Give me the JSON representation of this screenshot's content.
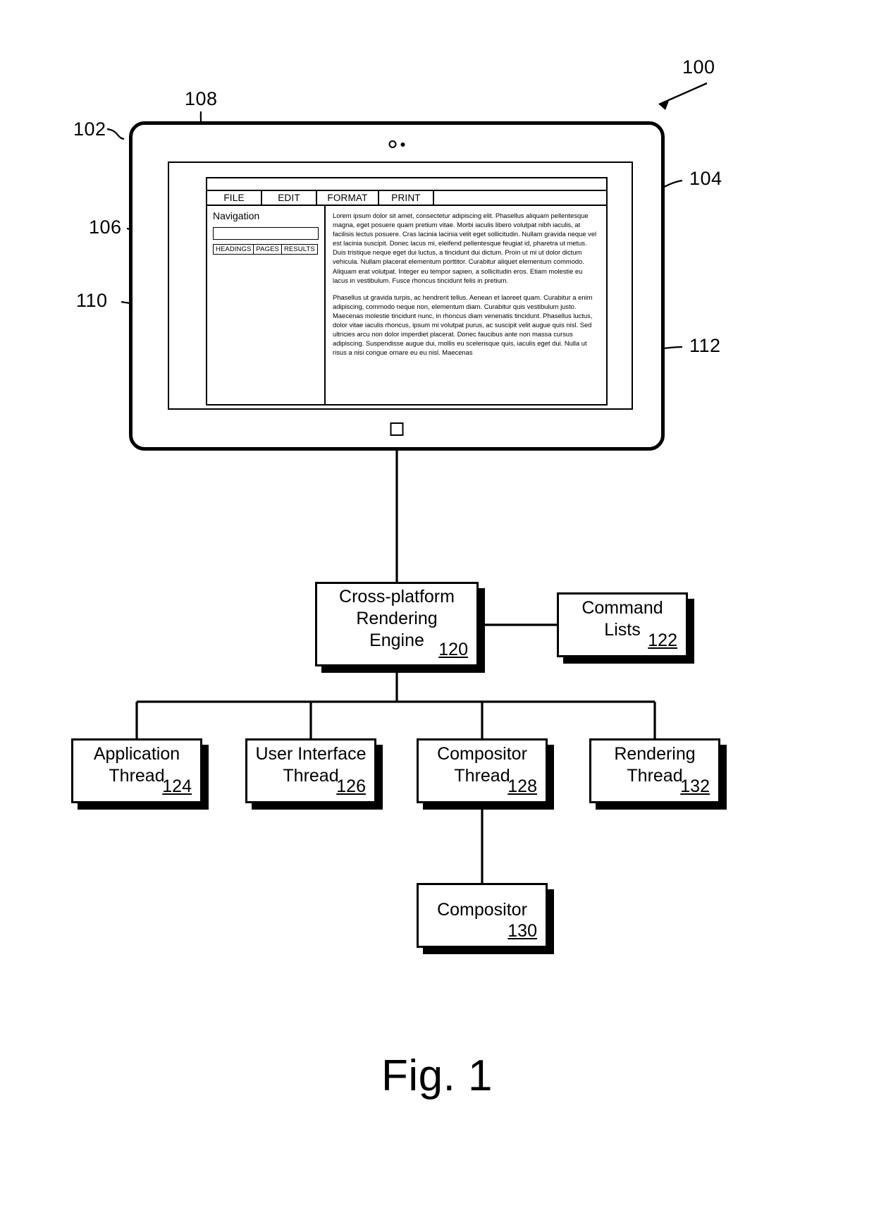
{
  "figure": {
    "caption": "Fig. 1",
    "top_ref": "100"
  },
  "refs": {
    "device": "102",
    "display": "104",
    "navigation_pane": "106",
    "menu_bar": "108",
    "nav_body": "110",
    "document_pane": "112"
  },
  "device": {
    "camera_icon": "camera-icon",
    "home_button_icon": "home-button-icon"
  },
  "app": {
    "menu": [
      {
        "label": "FILE"
      },
      {
        "label": "EDIT"
      },
      {
        "label": "FORMAT"
      },
      {
        "label": "PRINT"
      }
    ],
    "navigation": {
      "title": "Navigation",
      "search_value": "",
      "search_placeholder": "",
      "tabs": [
        {
          "label": "HEADINGS"
        },
        {
          "label": "PAGES"
        },
        {
          "label": "RESULTS"
        }
      ]
    },
    "document": {
      "paragraphs": [
        "Lorem ipsum dolor sit amet, consectetur adipiscing elit. Phasellus aliquam pellentesque magna, eget posuere quam pretium vitae. Morbi iaculis libero volutpat nibh iaculis, at facilisis lectus posuere. Cras lacinia lacinia velit eget sollicitudin. Nullam gravida neque vel est lacinia suscipit. Donec lacus mi, eleifend pellentesque feugiat id, pharetra ut metus. Duis tristique neque eget dui luctus, a tincidunt dui dictum. Proin ut mi ut dolor dictum vehicula. Nullam placerat elementum porttitor. Curabitur aliquet elementum commodo. Aliquam erat volutpat. Integer eu tempor sapien, a sollicitudin eros. Etiam molestie eu lacus in vestibulum. Fusce rhoncus tincidunt felis in pretium.",
        "Phasellus ut gravida turpis, ac hendrerit tellus. Aenean et laoreet quam. Curabitur a enim adipiscing, commodo neque non, elementum diam. Curabitur quis vestibulum justo. Maecenas molestie tincidunt nunc, in rhoncus diam venenatis tincidunt. Phasellus luctus, dolor vitae iaculis rhoncus, ipsum mi volutpat purus, ac suscipit velit augue quis nisl. Sed ultricies arcu non dolor imperdiet placerat. Donec faucibus ante non massa cursus adipiscing. Suspendisse augue dui, mollis eu scelerisque quis, iaculis eget dui. Nulla ut risus a nisi congue ornare eu eu nisl. Maecenas"
      ]
    }
  },
  "blocks": {
    "engine": {
      "line1": "Cross-platform",
      "line2": "Rendering",
      "line3": "Engine",
      "num": "120"
    },
    "command_lists": {
      "line1": "Command",
      "line2": "Lists",
      "num": "122"
    },
    "app_thread": {
      "line1": "Application",
      "line2": "Thread",
      "num": "124"
    },
    "ui_thread": {
      "line1": "User Interface",
      "line2": "Thread",
      "num": "126"
    },
    "comp_thread": {
      "line1": "Compositor",
      "line2": "Thread",
      "num": "128"
    },
    "render_thread": {
      "line1": "Rendering",
      "line2": "Thread",
      "num": "132"
    },
    "compositor": {
      "line1": "Compositor",
      "num": "130"
    }
  }
}
